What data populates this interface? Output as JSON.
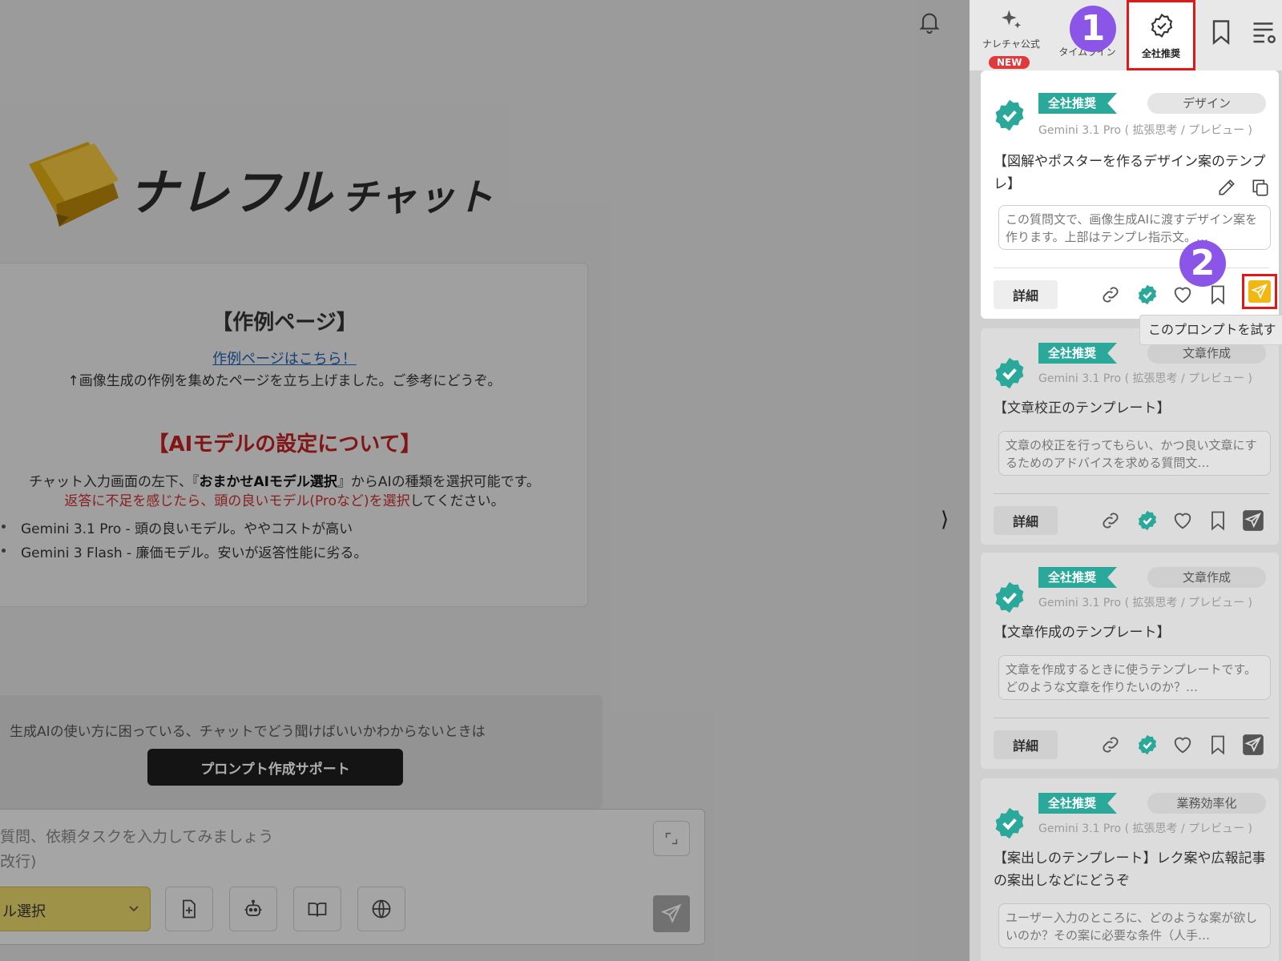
{
  "main": {
    "logo_text": "ナレフル",
    "logo_suffix": "チャット",
    "example_heading": "【作例ページ】",
    "example_link": "作例ページはこちら！",
    "example_note": "↑画像生成の作例を集めたページを立ち上げました。ご参考にどうぞ。",
    "ai_heading": "【AIモデルの設定について】",
    "ai_line1_pre": "チャット入力画面の左下、『",
    "ai_line1_bold": "おまかせAIモデル選択",
    "ai_line1_post": "』からAIの種類を選択可能です。",
    "ai_line2_red": "返答に不足を感じたら、頭の良いモデル(Proなど)を選択",
    "ai_line2_post": "してください。",
    "bullets": [
      "Gemini 3.1 Pro - 頭の良いモデル。ややコストが高い",
      "Gemini 3 Flash - 廉価モデル。安いが返答性能に劣る。"
    ],
    "support_text": "生成AIの使い方に困っている、チャットでどう聞けばいいかわからないときは",
    "support_button": "プロンプト作成サポート",
    "chat_placeholder": "質問、依頼タスクを入力してみましょう\n改行)",
    "model_select": "ル選択",
    "collapse_glyph": "⟩"
  },
  "panel": {
    "tabs": [
      {
        "label": "ナレチャ公式",
        "badge": "NEW"
      },
      {
        "label": "タイムライン"
      },
      {
        "label": "全社推奨"
      }
    ],
    "markers": [
      "1",
      "2"
    ],
    "tooltip": "このプロンプトを試す",
    "cards": [
      {
        "tag": "全社推奨",
        "category": "デザイン",
        "model": "Gemini 3.1 Pro ( 拡張思考 / プレビュー )",
        "title": "【図解やポスターを作るデザイン案のテンプレ】",
        "desc": "この質問文で、画像生成AIに渡すデザイン案を作ります。上部はテンプレ指示文。…",
        "detail": "詳細"
      },
      {
        "tag": "全社推奨",
        "category": "文章作成",
        "model": "Gemini 3.1 Pro ( 拡張思考 / プレビュー )",
        "title": "【文章校正のテンプレート】",
        "desc": "文章の校正を行ってもらい、かつ良い文章にするためのアドバイスを求める質問文…",
        "detail": "詳細"
      },
      {
        "tag": "全社推奨",
        "category": "文章作成",
        "model": "Gemini 3.1 Pro ( 拡張思考 / プレビュー )",
        "title": "【文章作成のテンプレート】",
        "desc": "文章を作成するときに使うテンプレートです。 どのような文章を作りたいのか？…",
        "detail": "詳細"
      },
      {
        "tag": "全社推奨",
        "category": "業務効率化",
        "model": "Gemini 3.1 Pro ( 拡張思考 / プレビュー )",
        "title": "【案出しのテンプレート】レク案や広報記事の案出しなどにどうぞ",
        "desc": "ユーザー入力のところに、どのような案が欲しいのか？その案に必要な条件（人手…",
        "detail": "詳細"
      }
    ]
  },
  "colors": {
    "accent_teal": "#2aa89a",
    "highlight_red": "#e01818",
    "marker_purple": "#8b55e8",
    "send_yellow": "#f2b712"
  }
}
